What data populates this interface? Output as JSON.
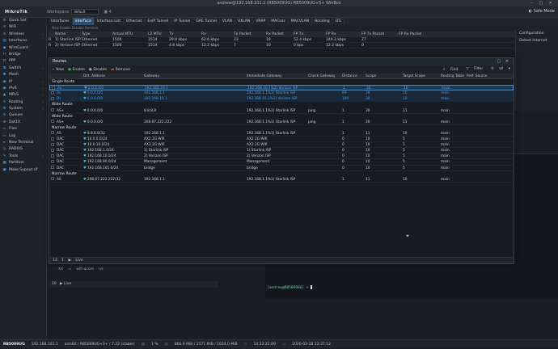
{
  "window": {
    "title": "andrew@192.168.101.1 (RB5009UG) RB5009UG+S+ WinBox",
    "controls": "– ▢ ✕"
  },
  "topbar": {
    "logo": "MikroTik",
    "workspace_label": "Workspace",
    "workspace_value": "default",
    "count": "4",
    "safe_mode": "Safe Mode"
  },
  "sidebar": {
    "items": [
      {
        "label": "Quick Set",
        "icon": "quickset-icon",
        "glyph": "⚙",
        "arrow": ""
      },
      {
        "label": "WiFi",
        "icon": "wifi-icon",
        "glyph": "≋",
        "arrow": ""
      },
      {
        "label": "Wireless",
        "icon": "wireless-icon",
        "glyph": "≋",
        "arrow": "›"
      },
      {
        "label": "Interfaces",
        "icon": "interfaces-icon",
        "glyph": "▤",
        "arrow": ""
      },
      {
        "label": "WireGuard",
        "icon": "wireguard-icon",
        "glyph": "◆",
        "arrow": ""
      },
      {
        "label": "Bridge",
        "icon": "bridge-icon",
        "glyph": "⊓",
        "arrow": ""
      },
      {
        "label": "PPP",
        "icon": "ppp-icon",
        "glyph": "⇄",
        "arrow": ""
      },
      {
        "label": "Switch",
        "icon": "switch-icon",
        "glyph": "⊞",
        "arrow": "›"
      },
      {
        "label": "Mesh",
        "icon": "mesh-icon",
        "glyph": "✱",
        "arrow": ""
      },
      {
        "label": "IP",
        "icon": "ip-icon",
        "glyph": "◉",
        "arrow": "›"
      },
      {
        "label": "IPv6",
        "icon": "ipv6-icon",
        "glyph": "◉",
        "arrow": "›"
      },
      {
        "label": "MPLS",
        "icon": "mpls-icon",
        "glyph": "▲",
        "arrow": "›"
      },
      {
        "label": "Routing",
        "icon": "routing-icon",
        "glyph": "↯",
        "arrow": "›"
      },
      {
        "label": "System",
        "icon": "system-icon",
        "glyph": "⚙",
        "arrow": "›"
      },
      {
        "label": "Queues",
        "icon": "queues-icon",
        "glyph": "≡",
        "arrow": ""
      },
      {
        "label": "Dot1X",
        "icon": "dot1x-icon",
        "glyph": "⊕",
        "arrow": ""
      },
      {
        "label": "Files",
        "icon": "files-icon",
        "glyph": "▭",
        "arrow": ""
      },
      {
        "label": "Log",
        "icon": "log-icon",
        "glyph": "▭",
        "arrow": ""
      },
      {
        "label": "New Terminal",
        "icon": "terminal-icon",
        "glyph": "▸",
        "arrow": ""
      },
      {
        "label": "RADIUS",
        "icon": "radius-icon",
        "glyph": "◎",
        "arrow": ""
      },
      {
        "label": "Tools",
        "icon": "tools-icon",
        "glyph": "✎",
        "arrow": "›"
      },
      {
        "label": "Partition",
        "icon": "partition-icon",
        "glyph": "▦",
        "arrow": ""
      },
      {
        "label": "Make Supout.rif",
        "icon": "supout-icon",
        "glyph": "▣",
        "arrow": ""
      }
    ]
  },
  "bg": {
    "tabs": [
      "Interfaces",
      "Interface",
      "Interface List",
      "Ethernet",
      "EoIP Tunnel",
      "IP Tunnel",
      "GRE Tunnel",
      "VLAN",
      "VXLAN",
      "VRRP",
      "MACsec",
      "MACVLAN",
      "Bonding",
      "LTE"
    ],
    "toolbar": "New   Enable   Disable   Remove",
    "if_headers": [
      "",
      "Name",
      "Type",
      "Actual MTU",
      "L2 MTU",
      "Tx",
      "Rx",
      "Tx Packet",
      "Rx Packet",
      "FP Tx",
      "FP Rx",
      "FP Tx Packet",
      "FP Rx Packet"
    ],
    "if_rows": [
      [
        "R",
        "1) Starlink ISP",
        "Ethernet",
        "1500",
        "1514",
        "29.9 kbps",
        "62.6 kbps",
        "23",
        "19",
        "52.4 kbps",
        "349.3 kbps",
        "27",
        ""
      ],
      [
        "R",
        "2) Verizon ISP",
        "Ethernet",
        "1500",
        "1514",
        "4.8 kbps",
        "12.2 kbps",
        "7",
        "10",
        "0 bps",
        "12.2 kbps",
        "0",
        ""
      ]
    ],
    "config": {
      "title": "Configuration",
      "item": "Detect Internet"
    },
    "low_rows": [
      {
        "flag": "X4",
        "name": "user-manager",
        "val": "no"
      },
      {
        "flag": "X4",
        "name": "wifi-qcom",
        "val": "no"
      }
    ],
    "low_foot": {
      "count": "16",
      "live": "Live"
    },
    "prompt": "[andrew@RB5009UG] >"
  },
  "routes": {
    "title": "Routes",
    "controls": "▢ ✕",
    "toolbar": {
      "new": "New",
      "enable": "Enable",
      "disable": "Disable",
      "remove": "Remove",
      "find": "Find",
      "filter": "Filter",
      "all": "all"
    },
    "headers": [
      "",
      "",
      "",
      "Dst. Address",
      "Gateway",
      "Immediate Gateway",
      "Check Gateway",
      "Distance",
      "Scope",
      "Target Scope",
      "Routing Table",
      "Pref. Source"
    ],
    "groups": [
      {
        "name": "Single Route",
        "rows": [
          {
            "style": "sel",
            "f": "As",
            "d": "0.0.0.0/0",
            "g": "192.168.10.1",
            "ig": "192.168.10.1%2) Verizon ISP",
            "cg": "",
            "dist": "2",
            "sc": "30",
            "ts": "10",
            "rt": "main",
            "ps": ""
          },
          {
            "style": "grpsel",
            "f": "Ds",
            "d": "0.0.0.0/0",
            "g": "192.168.1.1",
            "ig": "192.168.1.1%1) Starlink ISP",
            "cg": "",
            "dist": "99",
            "sc": "30",
            "ts": "10",
            "rt": "main",
            "ps": ""
          },
          {
            "style": "grpsel",
            "f": "Ds",
            "d": "0.0.0.0/0",
            "g": "192.168.10.1",
            "ig": "192.168.10.1%2) Verizon ISP",
            "cg": "",
            "dist": "100",
            "sc": "30",
            "ts": "10",
            "rt": "main",
            "ps": ""
          }
        ]
      },
      {
        "name": "Wide Route",
        "rows": [
          {
            "style": "",
            "f": "AS+",
            "d": "0.0.0.0/0",
            "g": "8.8.8.8",
            "ig": "192.168.1.1%1) Starlink ISP",
            "cg": "ping",
            "dist": "1",
            "sc": "30",
            "ts": "11",
            "rt": "main",
            "ps": ""
          }
        ]
      },
      {
        "name": "Wide Route",
        "rows": [
          {
            "style": "",
            "f": "AS+",
            "d": "0.0.0.0/0",
            "g": "208.67.222.222",
            "ig": "192.168.1.1%1) Starlink ISP",
            "cg": "ping",
            "dist": "1",
            "sc": "30",
            "ts": "11",
            "rt": "main",
            "ps": ""
          }
        ]
      },
      {
        "name": "Narrow Route",
        "rows": [
          {
            "style": "",
            "f": "AS",
            "d": "8.8.8.8/32",
            "g": "192.168.1.1",
            "ig": "192.168.1.1%1) Starlink ISP",
            "cg": "",
            "dist": "1",
            "sc": "11",
            "ts": "10",
            "rt": "main",
            "ps": ""
          },
          {
            "style": "",
            "f": "DAC",
            "d": "10.0.0.0/24",
            "g": "AX2 2G Wifi",
            "ig": "AX2 2G Wifi",
            "cg": "",
            "dist": "0",
            "sc": "10",
            "ts": "5",
            "rt": "main",
            "ps": ""
          },
          {
            "style": "",
            "f": "DAC",
            "d": "10.0.10.0/24",
            "g": "AX3 2G Wifi",
            "ig": "AX3 2G Wifi",
            "cg": "",
            "dist": "0",
            "sc": "10",
            "ts": "5",
            "rt": "main",
            "ps": ""
          },
          {
            "style": "",
            "f": "DAC",
            "d": "192.168.1.0/24",
            "g": "1) Starlink ISP",
            "ig": "1) Starlink ISP",
            "cg": "",
            "dist": "0",
            "sc": "10",
            "ts": "5",
            "rt": "main",
            "ps": ""
          },
          {
            "style": "",
            "f": "DAC",
            "d": "192.168.10.0/24",
            "g": "2) Verizon ISP",
            "ig": "2) Verizon ISP",
            "cg": "",
            "dist": "0",
            "sc": "10",
            "ts": "5",
            "rt": "main",
            "ps": ""
          },
          {
            "style": "",
            "f": "DAC",
            "d": "192.168.90.0/24",
            "g": "Management",
            "ig": "Management",
            "cg": "",
            "dist": "0",
            "sc": "10",
            "ts": "5",
            "rt": "main",
            "ps": ""
          },
          {
            "style": "",
            "f": "DAC",
            "d": "192.168.101.0/24",
            "g": "bridge",
            "ig": "bridge",
            "cg": "",
            "dist": "0",
            "sc": "10",
            "ts": "5",
            "rt": "main",
            "ps": ""
          }
        ]
      },
      {
        "name": "Narrow Route",
        "rows": [
          {
            "style": "",
            "f": "AS",
            "d": "208.67.222.222/32",
            "g": "192.168.1.1",
            "ig": "192.168.1.1%1) Starlink ISP",
            "cg": "",
            "dist": "1",
            "sc": "11",
            "ts": "10",
            "rt": "main",
            "ps": ""
          }
        ]
      }
    ],
    "footer": {
      "count": "13",
      "sep": "1",
      "live": "Live"
    }
  },
  "status": {
    "device": "RB5009UG",
    "ip": "192.168.101.1",
    "arch": "arm64 / RB5009UG+S+ / 7.22 (stable)",
    "cpu": "1 %",
    "mem": "866.9 MiB / 1571 MiB / 1024.0 MiB",
    "uptime": "1d 23:22:09",
    "date": "2026-03-18 12:37:12"
  },
  "colors": {
    "accent": "#2d4e6e",
    "selected_row": "#143a5e",
    "link_blue": "#5aa9e8",
    "add_green": "#3fae5a",
    "remove_red": "#d9534f"
  }
}
